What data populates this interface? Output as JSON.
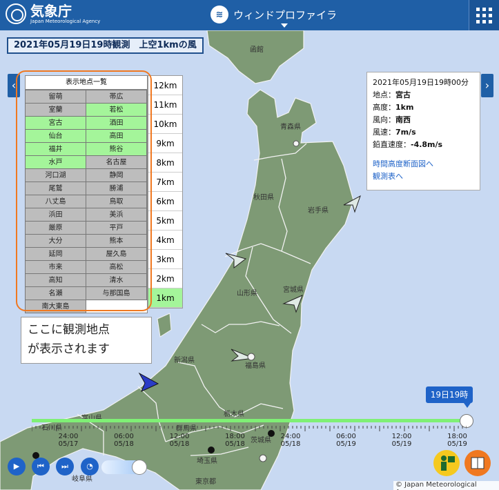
{
  "header": {
    "logo_ja": "気象庁",
    "logo_en": "Japan Meteorological Agency",
    "app_icon": "wind-icon",
    "app_title": "ウィンドプロファイラ",
    "menu_icon": "grid-menu-icon"
  },
  "observation_title": "2021年05月19日19時観測　上空1kmの風",
  "station_list": {
    "heading": "表示地点一覧",
    "stations": [
      {
        "name": "留萌",
        "active": false
      },
      {
        "name": "帯広",
        "active": false
      },
      {
        "name": "室蘭",
        "active": false
      },
      {
        "name": "若松",
        "active": true
      },
      {
        "name": "宮古",
        "active": true
      },
      {
        "name": "酒田",
        "active": true
      },
      {
        "name": "仙台",
        "active": true
      },
      {
        "name": "高田",
        "active": true
      },
      {
        "name": "福井",
        "active": true
      },
      {
        "name": "熊谷",
        "active": true
      },
      {
        "name": "水戸",
        "active": true
      },
      {
        "name": "名古屋",
        "active": false
      },
      {
        "name": "河口湖",
        "active": false
      },
      {
        "name": "静岡",
        "active": false
      },
      {
        "name": "尾鷲",
        "active": false
      },
      {
        "name": "勝浦",
        "active": false
      },
      {
        "name": "八丈島",
        "active": false
      },
      {
        "name": "鳥取",
        "active": false
      },
      {
        "name": "浜田",
        "active": false
      },
      {
        "name": "美浜",
        "active": false
      },
      {
        "name": "厳原",
        "active": false
      },
      {
        "name": "平戸",
        "active": false
      },
      {
        "name": "大分",
        "active": false
      },
      {
        "name": "熊本",
        "active": false
      },
      {
        "name": "延岡",
        "active": false
      },
      {
        "name": "屋久島",
        "active": false
      },
      {
        "name": "市来",
        "active": false
      },
      {
        "name": "高松",
        "active": false
      },
      {
        "name": "高知",
        "active": false
      },
      {
        "name": "清水",
        "active": false
      },
      {
        "name": "名瀬",
        "active": false
      },
      {
        "name": "与那国島",
        "active": false
      },
      {
        "name": "南大東島",
        "active": false
      }
    ]
  },
  "altitudes": [
    {
      "label": "12km",
      "active": false
    },
    {
      "label": "11km",
      "active": false
    },
    {
      "label": "10km",
      "active": false
    },
    {
      "label": "9km",
      "active": false
    },
    {
      "label": "8km",
      "active": false
    },
    {
      "label": "7km",
      "active": false
    },
    {
      "label": "6km",
      "active": false
    },
    {
      "label": "5km",
      "active": false
    },
    {
      "label": "4km",
      "active": false
    },
    {
      "label": "3km",
      "active": false
    },
    {
      "label": "2km",
      "active": false
    },
    {
      "label": "1km",
      "active": true
    }
  ],
  "callout": {
    "line1": "ここに観測地点",
    "line2": "が表示されます"
  },
  "info_popup": {
    "datetime": "2021年05月19日19時00分",
    "point_label": "地点：",
    "point_value": "宮古",
    "height_label": "高度：",
    "height_value": "1km",
    "direction_label": "風向：",
    "direction_value": "南西",
    "speed_label": "風速：",
    "speed_value": "7m/s",
    "vertical_label": "鉛直速度：",
    "vertical_value": "-4.8m/s",
    "link_cross_section": "時間高度断面図へ",
    "link_table": "観測表へ"
  },
  "prefectures": {
    "aomori": "青森県",
    "akita": "秋田県",
    "iwate": "岩手県",
    "yamagata": "山形県",
    "miyagi": "宮城県",
    "niigata": "新潟県",
    "fukushima": "福島県",
    "toyama": "富山県",
    "tochigi": "栃木県",
    "gunma": "群馬県",
    "ibaraki": "茨城県",
    "ishikawa": "石川県",
    "saitama": "埼玉県",
    "tokyo": "東京都",
    "gifu": "岐阜県",
    "hakodate": "函館"
  },
  "timeline": {
    "current_label": "19日19時",
    "progress": 1.0,
    "ticks": [
      {
        "time": "24:00",
        "date": "05/17"
      },
      {
        "time": "06:00",
        "date": "05/18"
      },
      {
        "time": "12:00",
        "date": "05/18"
      },
      {
        "time": "18:00",
        "date": "05/18"
      },
      {
        "time": "24:00",
        "date": "05/18"
      },
      {
        "time": "06:00",
        "date": "05/19"
      },
      {
        "time": "12:00",
        "date": "05/19"
      },
      {
        "time": "18:00",
        "date": "05/19"
      }
    ]
  },
  "controls": {
    "play_icon": "play-icon",
    "prev_icon": "step-back-icon",
    "next_icon": "step-forward-icon",
    "speed_icon": "speed-icon",
    "speed_level": 0.8,
    "help_icon": "help-person-icon",
    "book_icon": "book-icon"
  },
  "copyright": "© Japan Meteorological Agency",
  "colors": {
    "header": "#1f5fa6",
    "sea": "#c8d9f2",
    "land": "#7e9a75",
    "active_station": "#a4f59a",
    "inactive_station": "#bdbdbd",
    "timeline": "#7ff075",
    "highlight": "#f07820"
  }
}
